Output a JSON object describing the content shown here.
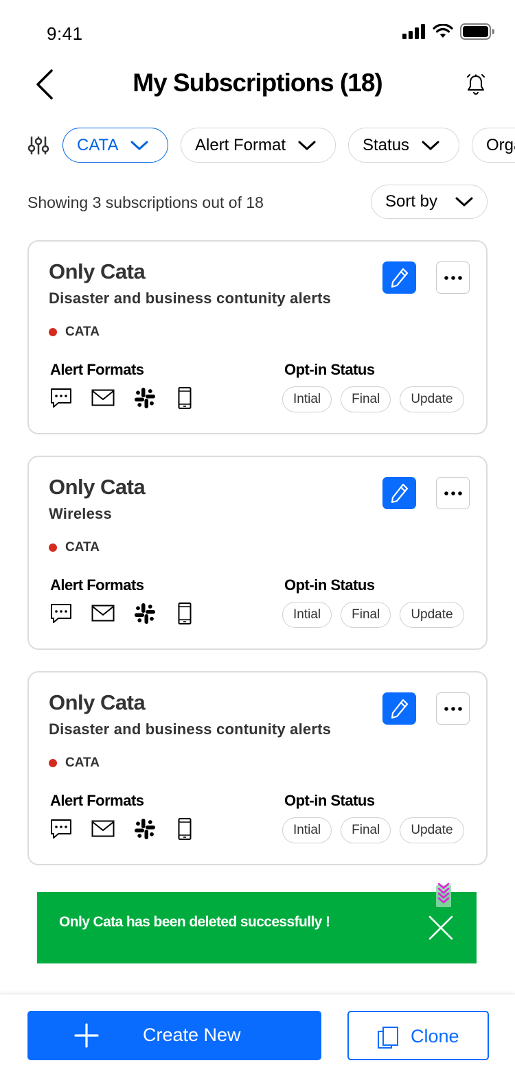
{
  "status_bar": {
    "time": "9:41"
  },
  "header": {
    "title": "My Subscriptions (18)"
  },
  "filters": [
    {
      "label": "CATA",
      "active": true
    },
    {
      "label": "Alert Format",
      "active": false
    },
    {
      "label": "Status",
      "active": false
    },
    {
      "label": "Orga",
      "active": false
    }
  ],
  "summary": {
    "count_text": "Showing 3 subscriptions out of 18",
    "sort_label": "Sort by"
  },
  "cards": [
    {
      "title": "Only Cata",
      "subtitle": "Disaster and business contunity alerts",
      "tag": "CATA",
      "formats_label": "Alert Formats",
      "formats": [
        "sms-icon",
        "email-icon",
        "slack-icon",
        "mobile-icon"
      ],
      "optin_label": "Opt-in Status",
      "statuses": [
        "Intial",
        "Final",
        "Update"
      ]
    },
    {
      "title": "Only Cata",
      "subtitle": "Wireless",
      "tag": "CATA",
      "formats_label": "Alert Formats",
      "formats": [
        "sms-icon",
        "email-icon",
        "slack-icon",
        "mobile-icon"
      ],
      "optin_label": "Opt-in Status",
      "statuses": [
        "Intial",
        "Final",
        "Update"
      ]
    },
    {
      "title": "Only Cata",
      "subtitle": "Disaster and business contunity alerts",
      "tag": "CATA",
      "formats_label": "Alert Formats",
      "formats": [
        "sms-icon",
        "email-icon",
        "slack-icon",
        "mobile-icon"
      ],
      "optin_label": "Opt-in Status",
      "statuses": [
        "Intial",
        "Final",
        "Update"
      ]
    }
  ],
  "toast": {
    "message": "Only Cata  has been deleted successfully !"
  },
  "footer": {
    "create_label": "Create New",
    "clone_label": "Clone"
  },
  "colors": {
    "accent": "#0a6cff",
    "success": "#00ac3e",
    "tag_dot": "#d52b1e"
  }
}
